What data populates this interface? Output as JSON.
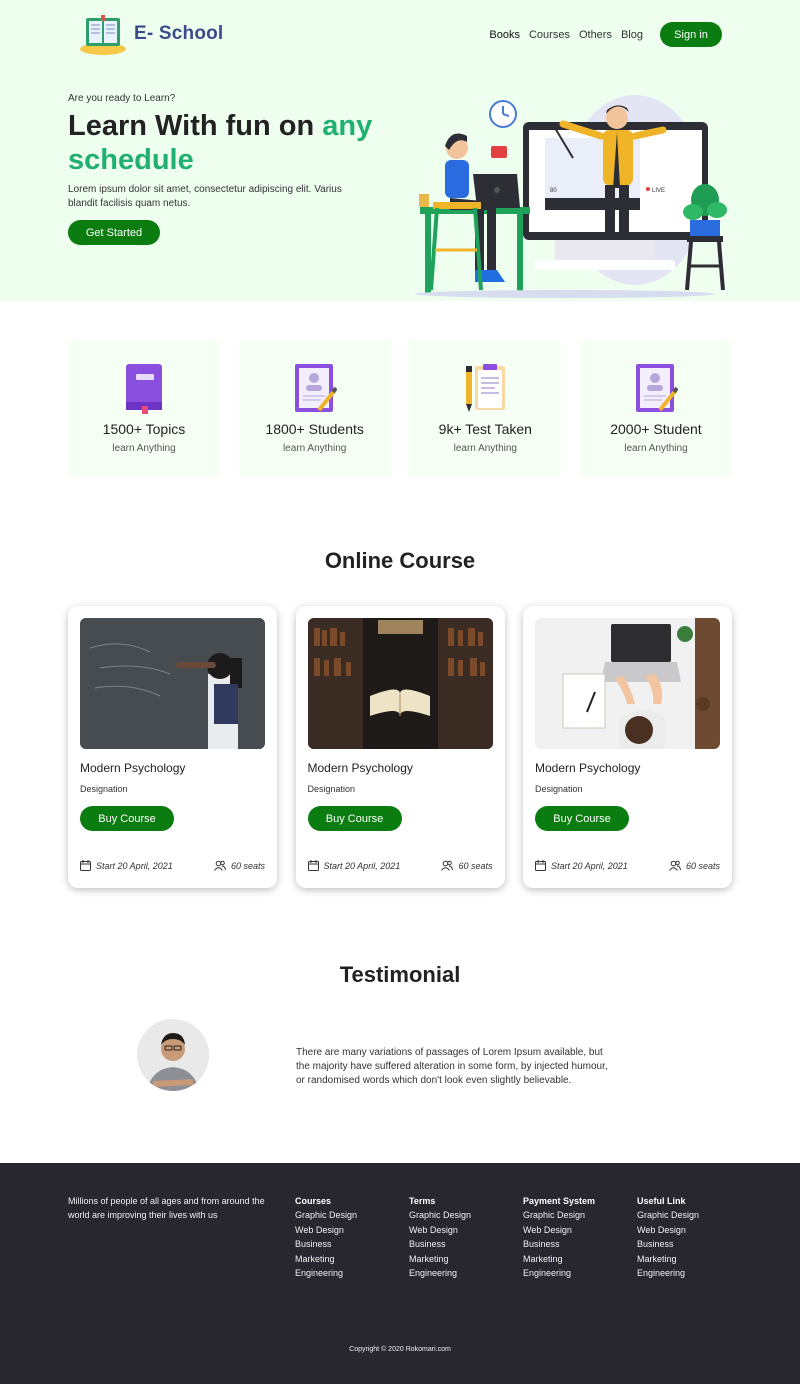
{
  "brand": {
    "name": "E- School"
  },
  "nav": {
    "links": [
      "Books",
      "Courses",
      "Others",
      "Blog"
    ],
    "signin_label": "Sign in"
  },
  "hero": {
    "kicker": "Are you ready to Learn?",
    "title_part1": "Learn With fun on ",
    "title_accent1": "any",
    "title_accent2": "schedule",
    "description": "Lorem ipsum dolor sit amet, consectetur adipiscing elit. Varius blandit facilisis quam netus.",
    "cta_label": "Get Started",
    "illustration": {
      "count_label": "80",
      "live_label": "LIVE"
    }
  },
  "stats": [
    {
      "value": "1500+ Topics",
      "sub": "learn Anything",
      "icon": "book-icon"
    },
    {
      "value": "1800+ Students",
      "sub": "learn Anything",
      "icon": "id-card-icon"
    },
    {
      "value": "9k+ Test Taken",
      "sub": "learn Anything",
      "icon": "clipboard-icon"
    },
    {
      "value": "2000+ Student",
      "sub": "learn Anything",
      "icon": "id-card-icon"
    }
  ],
  "courses": {
    "heading": "Online Course",
    "items": [
      {
        "title": "Modern Psychology",
        "subtitle": "Designation",
        "button": "Buy Course",
        "date": "Start 20 April, 2021",
        "seats": "60 seats"
      },
      {
        "title": "Modern Psychology",
        "subtitle": "Designation",
        "button": "Buy Course",
        "date": "Start 20 April, 2021",
        "seats": "60 seats"
      },
      {
        "title": "Modern Psychology",
        "subtitle": "Designation",
        "button": "Buy Course",
        "date": "Start 20 April, 2021",
        "seats": "60 seats"
      }
    ]
  },
  "testimonial": {
    "heading": "Testimonial",
    "quote": "There are many variations of passages of Lorem Ipsum available, but the majority have suffered alteration in some form, by injected humour, or randomised words which don't look even slightly believable."
  },
  "footer": {
    "about": "Millions of people of all ages and from around the world are improving their lives with us",
    "columns": [
      {
        "title": "Courses",
        "links": [
          "Graphic Design",
          "Web Design",
          "Business",
          "Marketing",
          "Engineering"
        ]
      },
      {
        "title": "Terms",
        "links": [
          "Graphic Design",
          "Web Design",
          "Business",
          "Marketing",
          "Engineering"
        ]
      },
      {
        "title": "Payment System",
        "links": [
          "Graphic Design",
          "Web Design",
          "Business",
          "Marketing",
          "Engineering"
        ]
      },
      {
        "title": "Useful Link",
        "links": [
          "Graphic Design",
          "Web Design",
          "Business",
          "Marketing",
          "Engineering"
        ]
      }
    ],
    "copyright": "Copyright © 2020 Rokomari.com"
  },
  "colors": {
    "primary_green": "#0b7d10",
    "accent_green": "#20b070",
    "hero_bg": "#eefff0",
    "footer_bg": "#28262f",
    "brand_text": "#3b4a8a"
  }
}
